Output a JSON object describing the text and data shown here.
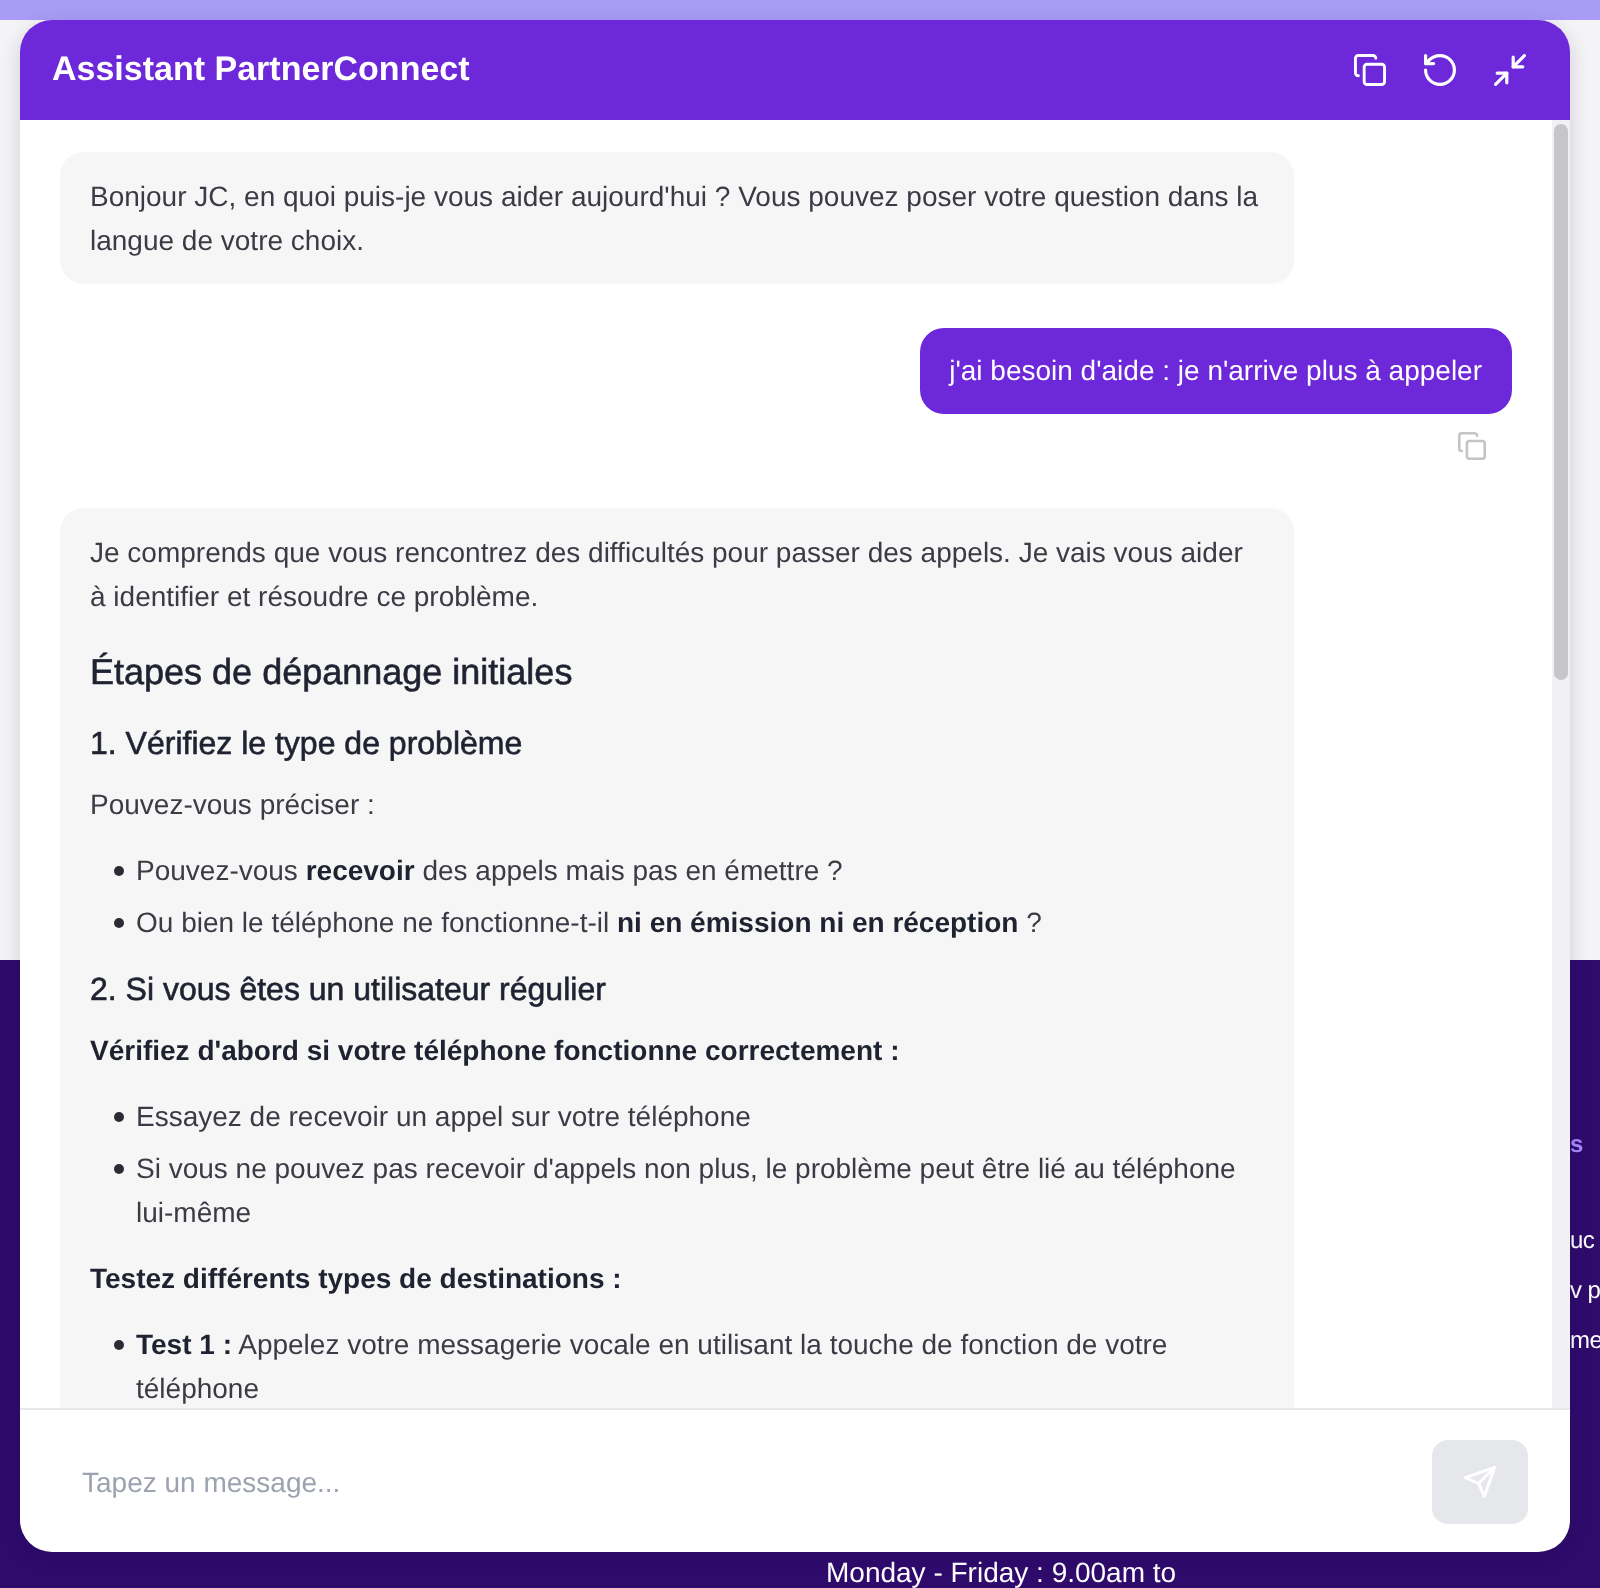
{
  "page": {
    "side_texts": [
      {
        "text": "s",
        "kind": "accent"
      },
      {
        "text": "uc",
        "kind": "plain"
      },
      {
        "text": "v p",
        "kind": "plain"
      },
      {
        "text": "me",
        "kind": "plain"
      }
    ],
    "hours": "Monday - Friday : 9.00am to"
  },
  "chat": {
    "title": "Assistant PartnerConnect",
    "messages": [
      {
        "kind": "assistant",
        "blocks": [
          {
            "kind": "paragraph",
            "text": "Bonjour JC, en quoi puis-je vous aider aujourd'hui ? Vous pouvez poser votre question dans la langue de votre choix."
          }
        ]
      },
      {
        "kind": "user",
        "text": "j'ai besoin d'aide : je n'arrive plus à appeler"
      },
      {
        "kind": "assistant",
        "blocks": [
          {
            "kind": "paragraph",
            "text": "Je comprends que vous rencontrez des difficultés pour passer des appels. Je vais vous aider à identifier et résoudre ce problème."
          },
          {
            "kind": "heading",
            "text": "Étapes de dépannage initiales"
          },
          {
            "kind": "subheading",
            "text": "1. Vérifiez le type de problème"
          },
          {
            "kind": "paragraph",
            "text": "Pouvez-vous préciser :"
          },
          {
            "kind": "list",
            "items": [
              "Pouvez-vous **recevoir** des appels mais pas en émettre ?",
              "Ou bien le téléphone ne fonctionne-t-il **ni en émission ni en réception** ?"
            ]
          },
          {
            "kind": "subheading",
            "text": "2. Si vous êtes un utilisateur régulier"
          },
          {
            "kind": "lead",
            "text": "Vérifiez d'abord si votre téléphone fonctionne correctement :"
          },
          {
            "kind": "list",
            "items": [
              "Essayez de recevoir un appel sur votre téléphone",
              "Si vous ne pouvez pas recevoir d'appels non plus, le problème peut être lié au téléphone lui-même"
            ]
          },
          {
            "kind": "lead",
            "text": "Testez différents types de destinations :"
          },
          {
            "kind": "list",
            "items": [
              "**Test 1 :** Appelez votre messagerie vocale en utilisant la touche de fonction de votre téléphone"
            ]
          }
        ]
      }
    ],
    "input": {
      "placeholder": "Tapez un message..."
    },
    "send_button": {
      "disabled": true
    }
  }
}
